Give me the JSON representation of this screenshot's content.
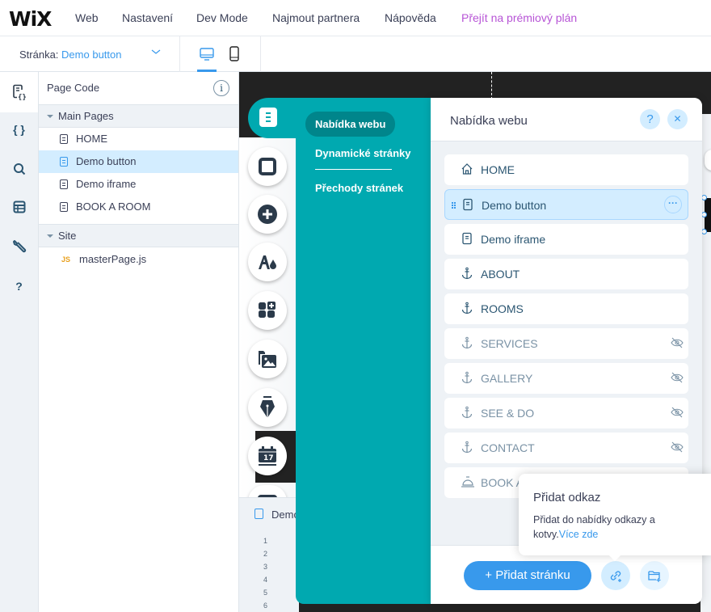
{
  "topbar": {
    "logo": "WiX",
    "menu": [
      "Web",
      "Nastavení",
      "Dev Mode",
      "Najmout partnera",
      "Nápověda"
    ],
    "premium": "Přejít na prémiový plán",
    "premium_color": "#b754d6"
  },
  "pagebar": {
    "label": "Stránka:",
    "value": "Demo button",
    "devices": [
      "desktop",
      "mobile"
    ],
    "active_device": "desktop"
  },
  "rail": {
    "items": [
      {
        "icon": "page-code-icon",
        "active": true
      },
      {
        "icon": "braces-icon",
        "glyph": "{ }"
      },
      {
        "icon": "search-icon"
      },
      {
        "icon": "database-icon"
      },
      {
        "icon": "wrench-icon"
      },
      {
        "icon": "help-icon",
        "glyph": "?"
      }
    ]
  },
  "files": {
    "title": "Page Code",
    "info_glyph": "i",
    "sections": [
      {
        "name": "Main Pages",
        "items": [
          "HOME",
          "Demo button",
          "Demo iframe",
          "BOOK A ROOM"
        ],
        "selected": "Demo button"
      },
      {
        "name": "Site",
        "items": [
          "masterPage.js"
        ],
        "badge": "JS"
      }
    ]
  },
  "code": {
    "tab_label": "Demo button",
    "line_numbers": [
      "1",
      "2",
      "3",
      "4",
      "5",
      "6"
    ]
  },
  "pages_panel": {
    "nav": [
      "Nabídka webu",
      "Dynamické stránky",
      "Přechody stránek"
    ],
    "active_nav": "Nabídka webu",
    "title": "Nabídka webu",
    "help_glyph": "?",
    "close_glyph": "✕",
    "items": [
      {
        "label": "HOME",
        "icon": "home-icon",
        "hidden": false
      },
      {
        "label": "Demo button",
        "icon": "page-icon",
        "hidden": false,
        "selected": true,
        "more_glyph": "···"
      },
      {
        "label": "Demo iframe",
        "icon": "page-icon",
        "hidden": false
      },
      {
        "label": "ABOUT",
        "icon": "anchor-icon",
        "hidden": false
      },
      {
        "label": "ROOMS",
        "icon": "anchor-icon",
        "hidden": false
      },
      {
        "label": "SERVICES",
        "icon": "anchor-icon",
        "hidden": true
      },
      {
        "label": "GALLERY",
        "icon": "anchor-icon",
        "hidden": true
      },
      {
        "label": "SEE & DO",
        "icon": "anchor-icon",
        "hidden": true
      },
      {
        "label": "CONTACT",
        "icon": "anchor-icon",
        "hidden": true
      },
      {
        "label": "BOOK A ROOM",
        "icon": "bell-icon",
        "hidden": true
      }
    ],
    "add_page": "+ Přidat stránku",
    "accent": "#3899ec",
    "teal": "#00a9b0"
  },
  "tooltip": {
    "title": "Přidat odkaz",
    "body": "Přidat do nabídky odkazy a kotvy.",
    "link": "Více zde"
  }
}
